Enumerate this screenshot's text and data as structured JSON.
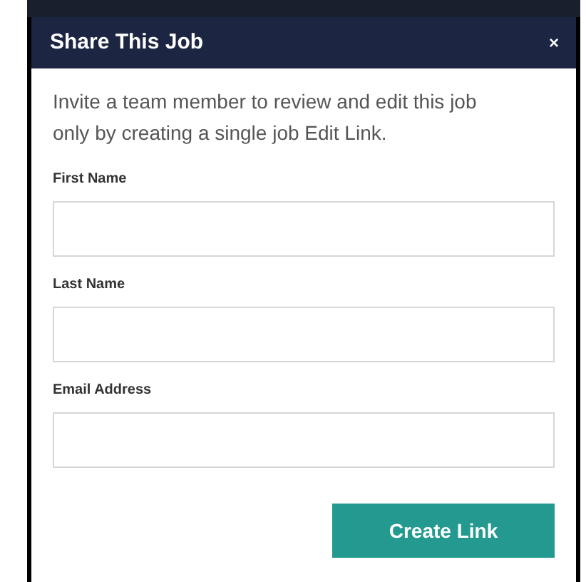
{
  "dialog": {
    "title": "Share This Job",
    "close": "×"
  },
  "intro": "Invite a team member to review and edit this job only by creating a single job Edit Link.",
  "fields": [
    {
      "label": "First Name"
    },
    {
      "label": "Last Name"
    },
    {
      "label": "Email Address"
    }
  ],
  "button": "Create Link"
}
